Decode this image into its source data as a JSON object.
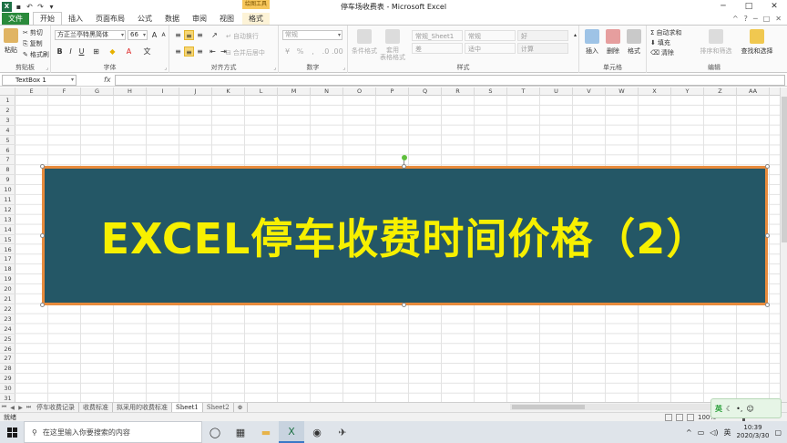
{
  "window": {
    "title": "停车场收费表 - Microsoft Excel"
  },
  "quick_access": [
    "save-icon",
    "undo-icon",
    "redo-icon"
  ],
  "tabs": {
    "file": "文件",
    "items": [
      "开始",
      "插入",
      "页面布局",
      "公式",
      "数据",
      "审阅",
      "视图"
    ],
    "context_group": "绘图工具",
    "context_tab": "格式",
    "active": "开始"
  },
  "ribbon": {
    "clipboard": {
      "label": "剪贴板",
      "paste": "粘贴",
      "cut": "剪切",
      "copy": "复制",
      "format_painter": "格式刷"
    },
    "font": {
      "label": "字体",
      "name": "方正兰亭特黑简体",
      "size": "66"
    },
    "alignment": {
      "label": "对齐方式",
      "wrap": "自动换行",
      "merge": "合并后居中"
    },
    "number": {
      "label": "数字",
      "format": "常规"
    },
    "styles": {
      "label": "样式",
      "cond_format": "条件格式",
      "table_format": "套用\n表格格式",
      "cells": [
        "常规_Sheet1",
        "常规",
        "好",
        "差",
        "适中",
        "计算"
      ]
    },
    "cells_group": {
      "label": "单元格",
      "insert": "插入",
      "delete": "删除",
      "format": "格式"
    },
    "editing": {
      "label": "编辑",
      "autosum": "自动求和",
      "fill": "填充",
      "clear": "清除",
      "sort": "排序和筛选",
      "find": "查找和选择"
    }
  },
  "formula_bar": {
    "name_box": "TextBox 1",
    "fx": "fx",
    "value": ""
  },
  "columns": [
    "E",
    "F",
    "G",
    "H",
    "I",
    "J",
    "K",
    "L",
    "M",
    "N",
    "O",
    "P",
    "Q",
    "R",
    "S",
    "T",
    "U",
    "V",
    "W",
    "X",
    "Y",
    "Z",
    "AA"
  ],
  "rows": [
    "1",
    "2",
    "3",
    "4",
    "5",
    "6",
    "7",
    "8",
    "9",
    "10",
    "11",
    "12",
    "13",
    "14",
    "15",
    "16",
    "17",
    "18",
    "19",
    "20",
    "21",
    "22",
    "23",
    "24",
    "25",
    "26",
    "27",
    "28",
    "29",
    "30",
    "31"
  ],
  "textbox": {
    "text": "EXCEL停车收费时间价格（2）",
    "fill": "#245766",
    "border": "#e88b3c",
    "text_color": "#f7f000"
  },
  "sheets": {
    "items": [
      "停车收费记录",
      "收费标准",
      "拟采用的收费标准",
      "Sheet1",
      "Sheet2"
    ],
    "active": "Sheet1"
  },
  "status": {
    "ready": "就绪",
    "zoom": "100%"
  },
  "ime": {
    "lang": "英"
  },
  "taskbar": {
    "search_placeholder": "在这里输入你要搜索的内容",
    "tray_lang": "英",
    "time": "10:39",
    "date": "2020/3/30"
  }
}
